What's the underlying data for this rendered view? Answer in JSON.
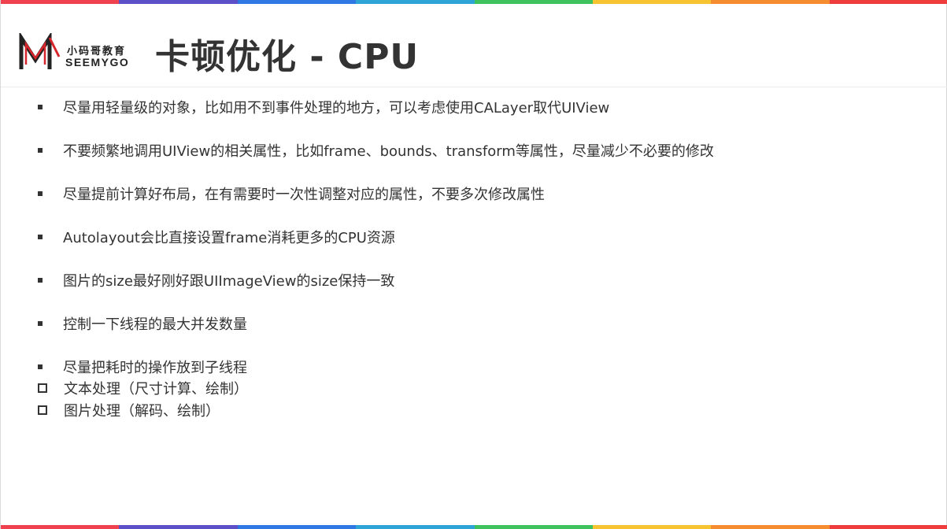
{
  "colors": {
    "stripe": [
      "#f0424e",
      "#5c4fc7",
      "#2f78e3",
      "#2da3d6",
      "#3dc25e",
      "#f5c430",
      "#f58c30",
      "#ef3d3d"
    ],
    "text": "#333333",
    "logo_red": "#d6262b",
    "logo_dark": "#222222"
  },
  "logo": {
    "cn": "小码哥教育",
    "en": "SEEMYGO"
  },
  "title": "卡顿优化 - CPU",
  "bullets": [
    {
      "type": "square",
      "text": "尽量用轻量级的对象，比如用不到事件处理的地方，可以考虑使用CALayer取代UIView"
    },
    {
      "type": "square",
      "text": "不要频繁地调用UIView的相关属性，比如frame、bounds、transform等属性，尽量减少不必要的修改"
    },
    {
      "type": "square",
      "text": "尽量提前计算好布局，在有需要时一次性调整对应的属性，不要多次修改属性"
    },
    {
      "type": "square",
      "text": "Autolayout会比直接设置frame消耗更多的CPU资源"
    },
    {
      "type": "square",
      "text": "图片的size最好刚好跟UIImageView的size保持一致"
    },
    {
      "type": "square",
      "text": "控制一下线程的最大并发数量"
    },
    {
      "type": "square",
      "text": "尽量把耗时的操作放到子线程"
    },
    {
      "type": "box",
      "text": "文本处理（尺寸计算、绘制）"
    },
    {
      "type": "box",
      "text": "图片处理（解码、绘制）"
    }
  ]
}
